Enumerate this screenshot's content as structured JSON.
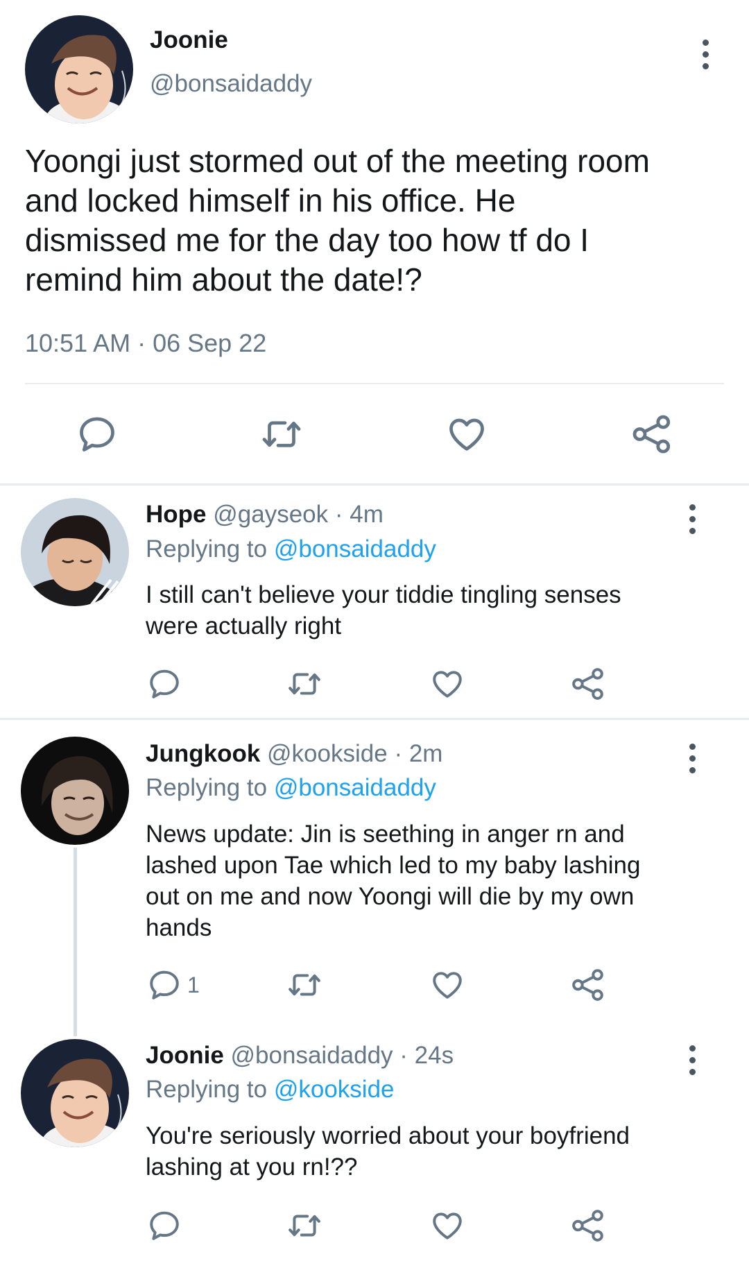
{
  "main_tweet": {
    "display_name": "Joonie",
    "handle": "@bonsaidaddy",
    "text": "Yoongi just stormed out of the meeting room\nand locked himself in his office. He\ndismissed me for the day too how tf do I\nremind him about the date!?",
    "timestamp": "10:51 AM · 06 Sep 22",
    "avatar_icon": "avatar-joonie"
  },
  "replies": [
    {
      "display_name": "Hope",
      "handle": "@gayseok",
      "age": "· 4m",
      "replying_prefix": "Replying to",
      "replying_to": "@bonsaidaddy",
      "text": "I still can't believe your tiddie tingling senses\nwere actually right",
      "reply_count": ""
    },
    {
      "display_name": "Jungkook",
      "handle": "@kookside",
      "age": "· 2m",
      "replying_prefix": "Replying to",
      "replying_to": "@bonsaidaddy",
      "text": "News update: Jin is seething in anger rn and\nlashed upon Tae which led to my baby lashing\nout on me and now Yoongi will die by my own\nhands",
      "reply_count": "1"
    },
    {
      "display_name": "Joonie",
      "handle": "@bonsaidaddy",
      "age": "· 24s",
      "replying_prefix": "Replying to",
      "replying_to": "@kookside",
      "text": "You're seriously worried about your boyfriend\nlashing at you rn!??",
      "reply_count": ""
    }
  ],
  "colors": {
    "link": "#1da1f2",
    "muted": "#657786",
    "icon": "#657786",
    "divider": "#e6ecf0"
  },
  "icons": [
    "reply-icon",
    "retweet-icon",
    "like-icon",
    "share-icon",
    "more-options-icon"
  ]
}
